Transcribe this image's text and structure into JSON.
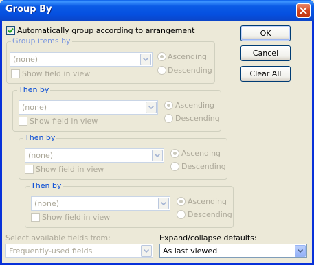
{
  "window": {
    "title": "Group By"
  },
  "auto_group": {
    "label": "Automatically group according to arrangement",
    "checked": true
  },
  "buttons": {
    "ok": "OK",
    "cancel": "Cancel",
    "clear_all": "Clear All"
  },
  "groups": [
    {
      "title": "Group items by",
      "field": "(none)",
      "show_field": "Show field in view",
      "ascending": "Ascending",
      "descending": "Descending"
    },
    {
      "title": "Then by",
      "field": "(none)",
      "show_field": "Show field in view",
      "ascending": "Ascending",
      "descending": "Descending"
    },
    {
      "title": "Then by",
      "field": "(none)",
      "show_field": "Show field in view",
      "ascending": "Ascending",
      "descending": "Descending"
    },
    {
      "title": "Then by",
      "field": "(none)",
      "show_field": "Show field in view",
      "ascending": "Ascending",
      "descending": "Descending"
    }
  ],
  "fields_from": {
    "label": "Select available fields from:",
    "value": "Frequently-used fields"
  },
  "expand_collapse": {
    "label": "Expand/collapse defaults:",
    "value": "As last viewed"
  },
  "icons": {
    "close": "close-icon",
    "check": "check-icon",
    "dropdown": "chevron-down-icon"
  },
  "colors": {
    "title_bar": "#0550e0",
    "group_title": "#0046d5",
    "face": "#ece9d8",
    "close": "#d2461f"
  }
}
